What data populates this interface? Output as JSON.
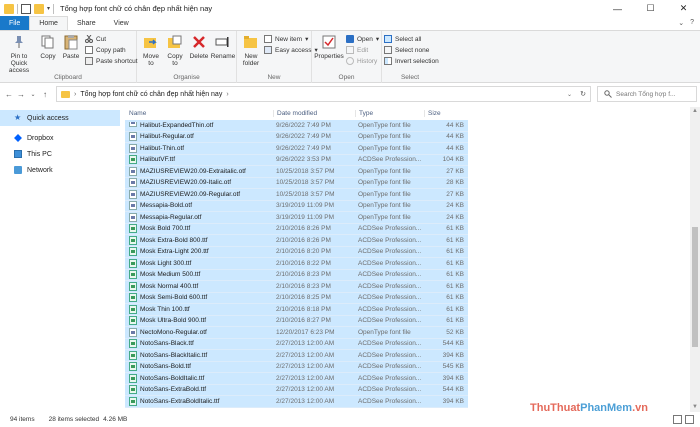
{
  "window": {
    "title": "Tổng hợp font chữ có chân đẹp nhất hiện nay",
    "controls": [
      "—",
      "☐",
      "✕"
    ]
  },
  "tabs": [
    "File",
    "Home",
    "Share",
    "View"
  ],
  "ribbon": {
    "clipboard": {
      "label": "Clipboard",
      "pin": "Pin to Quick access",
      "copy": "Copy",
      "paste": "Paste",
      "cut": "Cut",
      "copy_path": "Copy path",
      "paste_shortcut": "Paste shortcut"
    },
    "organise": {
      "label": "Organise",
      "move_to": "Move to",
      "copy_to": "Copy to",
      "delete": "Delete",
      "rename": "Rename"
    },
    "new": {
      "label": "New",
      "new_folder": "New folder",
      "new_item": "New item",
      "easy_access": "Easy access"
    },
    "open": {
      "label": "Open",
      "properties": "Properties",
      "open": "Open",
      "edit": "Edit",
      "history": "History"
    },
    "select": {
      "label": "Select",
      "select_all": "Select all",
      "select_none": "Select none",
      "invert": "Invert selection"
    }
  },
  "address": {
    "path": "Tổng hợp font chữ có chân đẹp nhất hiện nay",
    "search_placeholder": "Search Tổng hợp f..."
  },
  "nav": [
    {
      "label": "Quick access",
      "icon": "star-icon",
      "selected": true
    },
    {
      "label": "Dropbox",
      "icon": "dropbox-icon",
      "selected": false
    },
    {
      "label": "This PC",
      "icon": "computer-icon",
      "selected": false
    },
    {
      "label": "Network",
      "icon": "network-icon",
      "selected": false
    }
  ],
  "columns": {
    "name": "Name",
    "date": "Date modified",
    "type": "Type",
    "size": "Size"
  },
  "files": [
    {
      "name": "Halibut-ExpandedThin.otf",
      "date": "9/26/2022 7:49 PM",
      "type": "OpenType font file",
      "size": "44 KB",
      "kind": "otf"
    },
    {
      "name": "Halibut-Regular.otf",
      "date": "9/26/2022 7:49 PM",
      "type": "OpenType font file",
      "size": "44 KB",
      "kind": "otf"
    },
    {
      "name": "Halibut-Thin.otf",
      "date": "9/26/2022 7:49 PM",
      "type": "OpenType font file",
      "size": "44 KB",
      "kind": "otf"
    },
    {
      "name": "HalibutVF.ttf",
      "date": "9/26/2022 3:53 PM",
      "type": "ACDSee Profession...",
      "size": "104 KB",
      "kind": "ttf"
    },
    {
      "name": "MAZIUSREVIEW20.09-Extraitalic.otf",
      "date": "10/25/2018 3:57 PM",
      "type": "OpenType font file",
      "size": "27 KB",
      "kind": "otf"
    },
    {
      "name": "MAZIUSREVIEW20.09-Italic.otf",
      "date": "10/25/2018 3:57 PM",
      "type": "OpenType font file",
      "size": "28 KB",
      "kind": "otf"
    },
    {
      "name": "MAZIUSREVIEW20.09-Regular.otf",
      "date": "10/25/2018 3:57 PM",
      "type": "OpenType font file",
      "size": "27 KB",
      "kind": "otf"
    },
    {
      "name": "Messapia-Bold.otf",
      "date": "3/19/2019 11:09 PM",
      "type": "OpenType font file",
      "size": "24 KB",
      "kind": "otf"
    },
    {
      "name": "Messapia-Regular.otf",
      "date": "3/19/2019 11:09 PM",
      "type": "OpenType font file",
      "size": "24 KB",
      "kind": "otf"
    },
    {
      "name": "Mosk Bold 700.ttf",
      "date": "2/10/2016 8:26 PM",
      "type": "ACDSee Profession...",
      "size": "61 KB",
      "kind": "ttf"
    },
    {
      "name": "Mosk Extra-Bold 800.ttf",
      "date": "2/10/2016 8:26 PM",
      "type": "ACDSee Profession...",
      "size": "61 KB",
      "kind": "ttf"
    },
    {
      "name": "Mosk Extra-Light 200.ttf",
      "date": "2/10/2016 8:20 PM",
      "type": "ACDSee Profession...",
      "size": "61 KB",
      "kind": "ttf"
    },
    {
      "name": "Mosk Light 300.ttf",
      "date": "2/10/2016 8:22 PM",
      "type": "ACDSee Profession...",
      "size": "61 KB",
      "kind": "ttf"
    },
    {
      "name": "Mosk Medium 500.ttf",
      "date": "2/10/2016 8:23 PM",
      "type": "ACDSee Profession...",
      "size": "61 KB",
      "kind": "ttf"
    },
    {
      "name": "Mosk Normal 400.ttf",
      "date": "2/10/2016 8:23 PM",
      "type": "ACDSee Profession...",
      "size": "61 KB",
      "kind": "ttf"
    },
    {
      "name": "Mosk Semi-Bold 600.ttf",
      "date": "2/10/2016 8:25 PM",
      "type": "ACDSee Profession...",
      "size": "61 KB",
      "kind": "ttf"
    },
    {
      "name": "Mosk Thin 100.ttf",
      "date": "2/10/2016 8:18 PM",
      "type": "ACDSee Profession...",
      "size": "61 KB",
      "kind": "ttf"
    },
    {
      "name": "Mosk Ultra-Bold 900.ttf",
      "date": "2/10/2016 8:27 PM",
      "type": "ACDSee Profession...",
      "size": "61 KB",
      "kind": "ttf"
    },
    {
      "name": "NectoMono-Regular.otf",
      "date": "12/20/2017 6:23 PM",
      "type": "OpenType font file",
      "size": "52 KB",
      "kind": "otf"
    },
    {
      "name": "NotoSans-Black.ttf",
      "date": "2/27/2013 12:00 AM",
      "type": "ACDSee Profession...",
      "size": "544 KB",
      "kind": "ttf"
    },
    {
      "name": "NotoSans-BlackItalic.ttf",
      "date": "2/27/2013 12:00 AM",
      "type": "ACDSee Profession...",
      "size": "394 KB",
      "kind": "ttf"
    },
    {
      "name": "NotoSans-Bold.ttf",
      "date": "2/27/2013 12:00 AM",
      "type": "ACDSee Profession...",
      "size": "545 KB",
      "kind": "ttf"
    },
    {
      "name": "NotoSans-BoldItalic.ttf",
      "date": "2/27/2013 12:00 AM",
      "type": "ACDSee Profession...",
      "size": "394 KB",
      "kind": "ttf"
    },
    {
      "name": "NotoSans-ExtraBold.ttf",
      "date": "2/27/2013 12:00 AM",
      "type": "ACDSee Profession...",
      "size": "544 KB",
      "kind": "ttf"
    },
    {
      "name": "NotoSans-ExtraBoldItalic.ttf",
      "date": "2/27/2013 12:00 AM",
      "type": "ACDSee Profession...",
      "size": "394 KB",
      "kind": "ttf"
    }
  ],
  "status": {
    "items": "94 items",
    "selected": "28 items selected",
    "size": "4.26 MB"
  },
  "watermark": {
    "part1": "ThuThuat",
    "part2": "PhanMem",
    "part3": ".vn"
  }
}
